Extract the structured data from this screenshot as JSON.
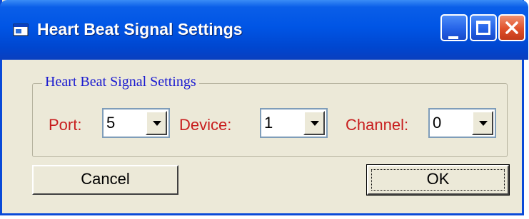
{
  "window": {
    "title": "Heart Beat Signal Settings",
    "icon": "app-window-icon",
    "controls": [
      "minimize-icon",
      "maximize-icon",
      "close-icon"
    ]
  },
  "group": {
    "legend": "Heart Beat Signal Settings"
  },
  "fields": {
    "port": {
      "label": "Port:",
      "value": "5"
    },
    "device": {
      "label": "Device:",
      "value": "1"
    },
    "channel": {
      "label": "Channel:",
      "value": "0"
    }
  },
  "buttons": {
    "cancel": "Cancel",
    "ok": "OK"
  },
  "colors": {
    "titlebar": "#0055E5",
    "label_red": "#C81E1E",
    "legend_blue": "#1A1AD0",
    "face": "#ECE9D8"
  }
}
